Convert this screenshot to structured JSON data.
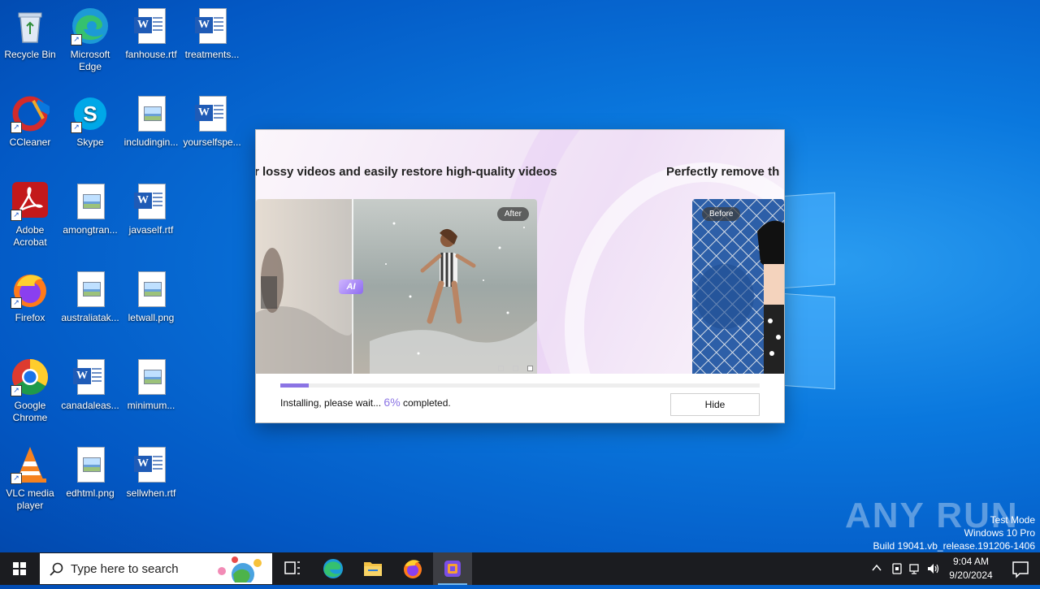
{
  "desktop": {
    "icons": [
      {
        "label": "Recycle Bin"
      },
      {
        "label": "Microsoft Edge"
      },
      {
        "label": "fanhouse.rtf"
      },
      {
        "label": "treatments..."
      },
      {
        "label": "CCleaner"
      },
      {
        "label": "Skype"
      },
      {
        "label": "includingin..."
      },
      {
        "label": "yourselfspe..."
      },
      {
        "label": "Adobe Acrobat"
      },
      {
        "label": "amongtran..."
      },
      {
        "label": "javaself.rtf"
      },
      {
        "label": "Firefox"
      },
      {
        "label": "australiatak..."
      },
      {
        "label": "letwall.png"
      },
      {
        "label": "Google Chrome"
      },
      {
        "label": "canadaleas..."
      },
      {
        "label": "minimum..."
      },
      {
        "label": "VLC media player"
      },
      {
        "label": "edhtml.png"
      },
      {
        "label": "sellwhen.rtf"
      }
    ]
  },
  "installer": {
    "heading_left": "r lossy videos and easily restore high-quality videos",
    "heading_right": "Perfectly remove th",
    "after_tag": "After",
    "before_tag": "Before",
    "ai_badge": "AI",
    "progress_fraction": 0.06,
    "status_prefix": "Installing, please wait...",
    "status_percent": "6%",
    "status_suffix": "completed.",
    "hide_label": "Hide",
    "accent": "#8b74e4"
  },
  "watermark": {
    "brand": "ANY RUN",
    "line1": "Test Mode",
    "line2": "Windows 10 Pro",
    "line3": "Build 19041.vb_release.191206-1406"
  },
  "taskbar": {
    "search_placeholder": "Type here to search",
    "time": "9:04 AM",
    "date": "9/20/2024",
    "apps": [
      "task-view-icon",
      "edge-icon",
      "file-explorer-icon",
      "firefox-icon",
      "installer-app-icon"
    ]
  }
}
